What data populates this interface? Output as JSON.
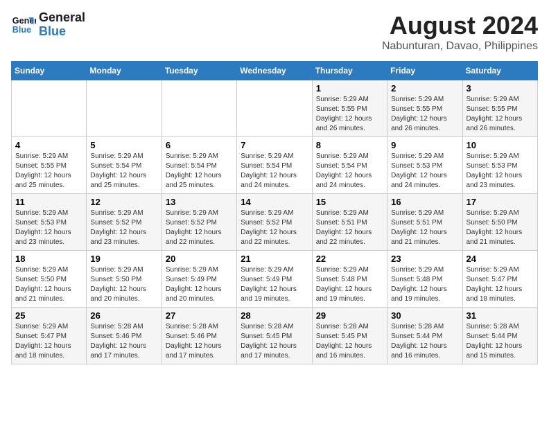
{
  "logo": {
    "line1": "General",
    "line2": "Blue"
  },
  "title": "August 2024",
  "subtitle": "Nabunturan, Davao, Philippines",
  "headers": [
    "Sunday",
    "Monday",
    "Tuesday",
    "Wednesday",
    "Thursday",
    "Friday",
    "Saturday"
  ],
  "weeks": [
    [
      {
        "day": "",
        "info": ""
      },
      {
        "day": "",
        "info": ""
      },
      {
        "day": "",
        "info": ""
      },
      {
        "day": "",
        "info": ""
      },
      {
        "day": "1",
        "info": "Sunrise: 5:29 AM\nSunset: 5:55 PM\nDaylight: 12 hours\nand 26 minutes."
      },
      {
        "day": "2",
        "info": "Sunrise: 5:29 AM\nSunset: 5:55 PM\nDaylight: 12 hours\nand 26 minutes."
      },
      {
        "day": "3",
        "info": "Sunrise: 5:29 AM\nSunset: 5:55 PM\nDaylight: 12 hours\nand 26 minutes."
      }
    ],
    [
      {
        "day": "4",
        "info": "Sunrise: 5:29 AM\nSunset: 5:55 PM\nDaylight: 12 hours\nand 25 minutes."
      },
      {
        "day": "5",
        "info": "Sunrise: 5:29 AM\nSunset: 5:54 PM\nDaylight: 12 hours\nand 25 minutes."
      },
      {
        "day": "6",
        "info": "Sunrise: 5:29 AM\nSunset: 5:54 PM\nDaylight: 12 hours\nand 25 minutes."
      },
      {
        "day": "7",
        "info": "Sunrise: 5:29 AM\nSunset: 5:54 PM\nDaylight: 12 hours\nand 24 minutes."
      },
      {
        "day": "8",
        "info": "Sunrise: 5:29 AM\nSunset: 5:54 PM\nDaylight: 12 hours\nand 24 minutes."
      },
      {
        "day": "9",
        "info": "Sunrise: 5:29 AM\nSunset: 5:53 PM\nDaylight: 12 hours\nand 24 minutes."
      },
      {
        "day": "10",
        "info": "Sunrise: 5:29 AM\nSunset: 5:53 PM\nDaylight: 12 hours\nand 23 minutes."
      }
    ],
    [
      {
        "day": "11",
        "info": "Sunrise: 5:29 AM\nSunset: 5:53 PM\nDaylight: 12 hours\nand 23 minutes."
      },
      {
        "day": "12",
        "info": "Sunrise: 5:29 AM\nSunset: 5:52 PM\nDaylight: 12 hours\nand 23 minutes."
      },
      {
        "day": "13",
        "info": "Sunrise: 5:29 AM\nSunset: 5:52 PM\nDaylight: 12 hours\nand 22 minutes."
      },
      {
        "day": "14",
        "info": "Sunrise: 5:29 AM\nSunset: 5:52 PM\nDaylight: 12 hours\nand 22 minutes."
      },
      {
        "day": "15",
        "info": "Sunrise: 5:29 AM\nSunset: 5:51 PM\nDaylight: 12 hours\nand 22 minutes."
      },
      {
        "day": "16",
        "info": "Sunrise: 5:29 AM\nSunset: 5:51 PM\nDaylight: 12 hours\nand 21 minutes."
      },
      {
        "day": "17",
        "info": "Sunrise: 5:29 AM\nSunset: 5:50 PM\nDaylight: 12 hours\nand 21 minutes."
      }
    ],
    [
      {
        "day": "18",
        "info": "Sunrise: 5:29 AM\nSunset: 5:50 PM\nDaylight: 12 hours\nand 21 minutes."
      },
      {
        "day": "19",
        "info": "Sunrise: 5:29 AM\nSunset: 5:50 PM\nDaylight: 12 hours\nand 20 minutes."
      },
      {
        "day": "20",
        "info": "Sunrise: 5:29 AM\nSunset: 5:49 PM\nDaylight: 12 hours\nand 20 minutes."
      },
      {
        "day": "21",
        "info": "Sunrise: 5:29 AM\nSunset: 5:49 PM\nDaylight: 12 hours\nand 19 minutes."
      },
      {
        "day": "22",
        "info": "Sunrise: 5:29 AM\nSunset: 5:48 PM\nDaylight: 12 hours\nand 19 minutes."
      },
      {
        "day": "23",
        "info": "Sunrise: 5:29 AM\nSunset: 5:48 PM\nDaylight: 12 hours\nand 19 minutes."
      },
      {
        "day": "24",
        "info": "Sunrise: 5:29 AM\nSunset: 5:47 PM\nDaylight: 12 hours\nand 18 minutes."
      }
    ],
    [
      {
        "day": "25",
        "info": "Sunrise: 5:29 AM\nSunset: 5:47 PM\nDaylight: 12 hours\nand 18 minutes."
      },
      {
        "day": "26",
        "info": "Sunrise: 5:28 AM\nSunset: 5:46 PM\nDaylight: 12 hours\nand 17 minutes."
      },
      {
        "day": "27",
        "info": "Sunrise: 5:28 AM\nSunset: 5:46 PM\nDaylight: 12 hours\nand 17 minutes."
      },
      {
        "day": "28",
        "info": "Sunrise: 5:28 AM\nSunset: 5:45 PM\nDaylight: 12 hours\nand 17 minutes."
      },
      {
        "day": "29",
        "info": "Sunrise: 5:28 AM\nSunset: 5:45 PM\nDaylight: 12 hours\nand 16 minutes."
      },
      {
        "day": "30",
        "info": "Sunrise: 5:28 AM\nSunset: 5:44 PM\nDaylight: 12 hours\nand 16 minutes."
      },
      {
        "day": "31",
        "info": "Sunrise: 5:28 AM\nSunset: 5:44 PM\nDaylight: 12 hours\nand 15 minutes."
      }
    ]
  ]
}
